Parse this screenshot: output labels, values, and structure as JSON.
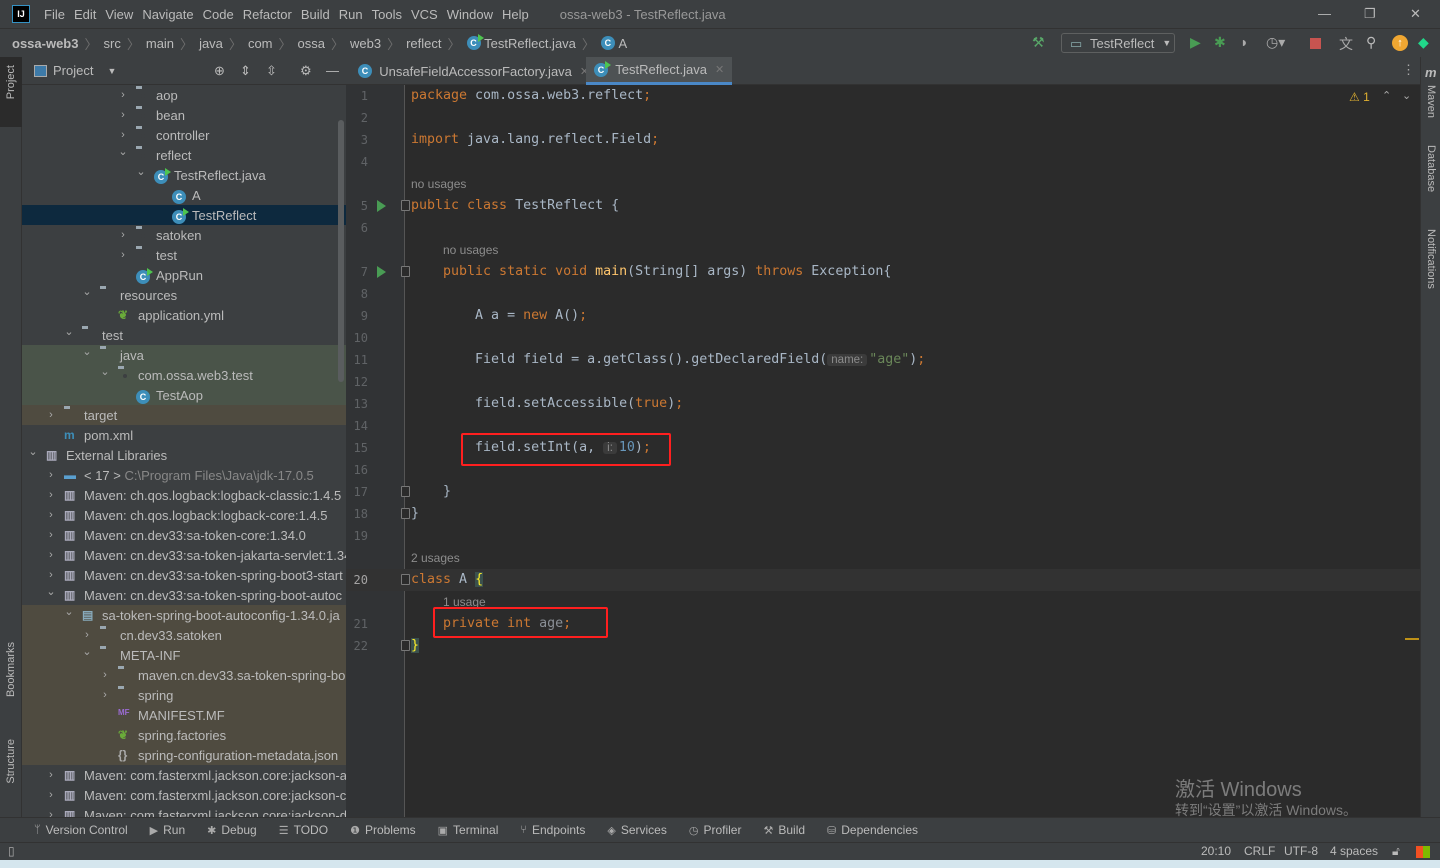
{
  "window": {
    "title": "ossa-web3 - TestReflect.java",
    "menu": [
      "File",
      "Edit",
      "View",
      "Navigate",
      "Code",
      "Refactor",
      "Build",
      "Run",
      "Tools",
      "VCS",
      "Window",
      "Help"
    ],
    "logo": "IJ"
  },
  "breadcrumb": [
    "ossa-web3",
    "src",
    "main",
    "java",
    "com",
    "ossa",
    "web3",
    "reflect",
    "TestReflect.java",
    "A"
  ],
  "toolbar": {
    "run_config": "TestReflect",
    "icons": [
      "hammer-icon",
      "run-icon",
      "debug-icon",
      "coverage-icon",
      "profile-icon",
      "stop-icon",
      "translate-icon",
      "search-icon",
      "update-icon",
      "toolbox-icon"
    ]
  },
  "project": {
    "title": "Project",
    "tree": [
      {
        "label": "aop",
        "level": 5,
        "state": "collapsed",
        "icon": "package"
      },
      {
        "label": "bean",
        "level": 5,
        "state": "collapsed",
        "icon": "package"
      },
      {
        "label": "controller",
        "level": 5,
        "state": "collapsed",
        "icon": "package"
      },
      {
        "label": "reflect",
        "level": 5,
        "state": "expanded",
        "icon": "package"
      },
      {
        "label": "TestReflect.java",
        "level": 6,
        "state": "expanded",
        "icon": "class-run"
      },
      {
        "label": "A",
        "level": 7,
        "state": "leaf",
        "icon": "class"
      },
      {
        "label": "TestReflect",
        "level": 7,
        "state": "leaf",
        "icon": "class-run",
        "selected": true
      },
      {
        "label": "satoken",
        "level": 5,
        "state": "collapsed",
        "icon": "package"
      },
      {
        "label": "test",
        "level": 5,
        "state": "collapsed",
        "icon": "package"
      },
      {
        "label": "AppRun",
        "level": 5,
        "state": "leaf",
        "icon": "class-run"
      },
      {
        "label": "resources",
        "level": 3,
        "state": "expanded",
        "icon": "resources"
      },
      {
        "label": "application.yml",
        "level": 4,
        "state": "leaf",
        "icon": "spring"
      },
      {
        "label": "test",
        "level": 2,
        "state": "expanded",
        "icon": "folder"
      },
      {
        "label": "java",
        "level": 3,
        "state": "expanded",
        "icon": "test-folder",
        "bg": "green"
      },
      {
        "label": "com.ossa.web3.test",
        "level": 4,
        "state": "expanded",
        "icon": "package",
        "bg": "green"
      },
      {
        "label": "TestAop",
        "level": 5,
        "state": "leaf",
        "icon": "class",
        "bg": "green"
      },
      {
        "label": "target",
        "level": 1,
        "state": "collapsed",
        "icon": "excluded",
        "bg": "brown"
      },
      {
        "label": "pom.xml",
        "level": 1,
        "state": "leaf",
        "icon": "maven"
      },
      {
        "label": "External Libraries",
        "level": 0,
        "state": "expanded",
        "icon": "library"
      },
      {
        "label": "< 17 >",
        "extra": "C:\\Program Files\\Java\\jdk-17.0.5",
        "level": 1,
        "state": "collapsed",
        "icon": "jdk"
      },
      {
        "label": "Maven: ch.qos.logback:logback-classic:1.4.5",
        "level": 1,
        "state": "collapsed",
        "icon": "library"
      },
      {
        "label": "Maven: ch.qos.logback:logback-core:1.4.5",
        "level": 1,
        "state": "collapsed",
        "icon": "library"
      },
      {
        "label": "Maven: cn.dev33:sa-token-core:1.34.0",
        "level": 1,
        "state": "collapsed",
        "icon": "library"
      },
      {
        "label": "Maven: cn.dev33:sa-token-jakarta-servlet:1.34",
        "level": 1,
        "state": "collapsed",
        "icon": "library"
      },
      {
        "label": "Maven: cn.dev33:sa-token-spring-boot3-start",
        "level": 1,
        "state": "collapsed",
        "icon": "library"
      },
      {
        "label": "Maven: cn.dev33:sa-token-spring-boot-autoc",
        "level": 1,
        "state": "expanded",
        "icon": "library"
      },
      {
        "label": "sa-token-spring-boot-autoconfig-1.34.0.ja",
        "level": 2,
        "state": "expanded",
        "icon": "jar",
        "bg": "brown"
      },
      {
        "label": "cn.dev33.satoken",
        "level": 3,
        "state": "collapsed",
        "icon": "folder",
        "bg": "brown"
      },
      {
        "label": "META-INF",
        "level": 3,
        "state": "expanded",
        "icon": "folder",
        "bg": "brown"
      },
      {
        "label": "maven.cn.dev33.sa-token-spring-bo",
        "level": 4,
        "state": "collapsed",
        "icon": "folder",
        "bg": "brown"
      },
      {
        "label": "spring",
        "level": 4,
        "state": "collapsed",
        "icon": "folder",
        "bg": "brown"
      },
      {
        "label": "MANIFEST.MF",
        "level": 4,
        "state": "leaf",
        "icon": "manifest",
        "bg": "brown"
      },
      {
        "label": "spring.factories",
        "level": 4,
        "state": "leaf",
        "icon": "spring",
        "bg": "brown"
      },
      {
        "label": "spring-configuration-metadata.json",
        "level": 4,
        "state": "leaf",
        "icon": "json",
        "bg": "brown"
      },
      {
        "label": "Maven: com.fasterxml.jackson.core:jackson-a",
        "level": 1,
        "state": "collapsed",
        "icon": "library"
      },
      {
        "label": "Maven: com.fasterxml.jackson.core:jackson-c",
        "level": 1,
        "state": "collapsed",
        "icon": "library"
      },
      {
        "label": "Maven: com.fasterxml.jackson.core:jackson-d",
        "level": 1,
        "state": "collapsed",
        "icon": "library"
      }
    ]
  },
  "editor": {
    "tabs": [
      {
        "label": "UnsafeFieldAccessorFactory.java",
        "active": false
      },
      {
        "label": "TestReflect.java",
        "active": true
      }
    ],
    "warnings": "1",
    "current_line": 20,
    "rows": [
      {
        "n": 1,
        "t": [
          [
            "package ",
            "kw"
          ],
          [
            "com.ossa.web3.reflect",
            "pl"
          ],
          [
            ";",
            "kw"
          ]
        ]
      },
      {
        "n": 2,
        "t": []
      },
      {
        "n": 3,
        "t": [
          [
            "import ",
            "kw"
          ],
          [
            "java.lang.reflect.Field",
            "pl"
          ],
          [
            ";",
            "kw"
          ]
        ]
      },
      {
        "n": 4,
        "t": []
      },
      {
        "hint": "no usages",
        "indent": 0
      },
      {
        "n": 5,
        "run": true,
        "fold": true,
        "t": [
          [
            "public class ",
            "kw"
          ],
          [
            "TestReflect {",
            "pl"
          ]
        ]
      },
      {
        "n": 6,
        "t": []
      },
      {
        "hint": "no usages",
        "indent": 4
      },
      {
        "n": 7,
        "run": true,
        "fold": true,
        "t": [
          [
            "    public static void ",
            "kw"
          ],
          [
            "main",
            "fn"
          ],
          [
            "(String[] args) ",
            "pl"
          ],
          [
            "throws ",
            "kw"
          ],
          [
            "Exception{",
            "pl"
          ]
        ]
      },
      {
        "n": 8,
        "t": []
      },
      {
        "n": 9,
        "t": [
          [
            "        A a = ",
            "pl"
          ],
          [
            "new ",
            "kw"
          ],
          [
            "A()",
            "pl"
          ],
          [
            ";",
            "kw"
          ]
        ]
      },
      {
        "n": 10,
        "t": []
      },
      {
        "n": 11,
        "t": [
          [
            "        Field field = a.getClass().getDeclaredField(",
            "pl"
          ],
          [
            "name:",
            "inlay"
          ],
          [
            "\"age\"",
            "str"
          ],
          [
            ")",
            "pl"
          ],
          [
            ";",
            "kw"
          ]
        ]
      },
      {
        "n": 12,
        "t": []
      },
      {
        "n": 13,
        "t": [
          [
            "        field.setAccessible(",
            "pl"
          ],
          [
            "true",
            "kw"
          ],
          [
            ")",
            "pl"
          ],
          [
            ";",
            "kw"
          ]
        ]
      },
      {
        "n": 14,
        "t": []
      },
      {
        "n": 15,
        "t": [
          [
            "        field.setInt(a, ",
            "pl"
          ],
          [
            "i:",
            "inlay"
          ],
          [
            "10",
            "num"
          ],
          [
            ")",
            "pl"
          ],
          [
            ";",
            "kw"
          ]
        ]
      },
      {
        "n": 16,
        "t": []
      },
      {
        "n": 17,
        "fold": true,
        "t": [
          [
            "    }",
            "pl"
          ]
        ]
      },
      {
        "n": 18,
        "fold": true,
        "t": [
          [
            "}",
            "pl"
          ]
        ]
      },
      {
        "n": 19,
        "t": []
      },
      {
        "hint": "2 usages",
        "indent": 0
      },
      {
        "n": 20,
        "fold": true,
        "t": [
          [
            "class ",
            "kw"
          ],
          [
            "A ",
            "pl"
          ],
          [
            "{",
            "brace"
          ]
        ]
      },
      {
        "hint": "1 usage",
        "indent": 4
      },
      {
        "n": 21,
        "t": [
          [
            "    private int ",
            "kw"
          ],
          [
            "age",
            "gray"
          ],
          [
            ";",
            "kw"
          ]
        ]
      },
      {
        "n": 22,
        "fold": true,
        "t": [
          [
            "}",
            "brace"
          ]
        ]
      }
    ]
  },
  "right_stripe": [
    "Maven",
    "Database",
    "Notifications"
  ],
  "left_stripe": {
    "top": "Project",
    "bottom": [
      "Bookmarks",
      "Structure"
    ]
  },
  "tool_windows": [
    "Version Control",
    "Run",
    "Debug",
    "TODO",
    "Problems",
    "Terminal",
    "Endpoints",
    "Services",
    "Profiler",
    "Build",
    "Dependencies"
  ],
  "status": {
    "position": "20:10",
    "line_sep": "CRLF",
    "encoding": "UTF-8",
    "indent": "4 spaces"
  },
  "watermark": {
    "line1": "激活 Windows",
    "line2": "转到“设置”以激活 Windows。"
  },
  "colors": {
    "accent": "#4a88c7",
    "highlight_box": "#ff1f1f",
    "keyword": "#cc7832",
    "string": "#6a8759",
    "number": "#6897bb"
  }
}
